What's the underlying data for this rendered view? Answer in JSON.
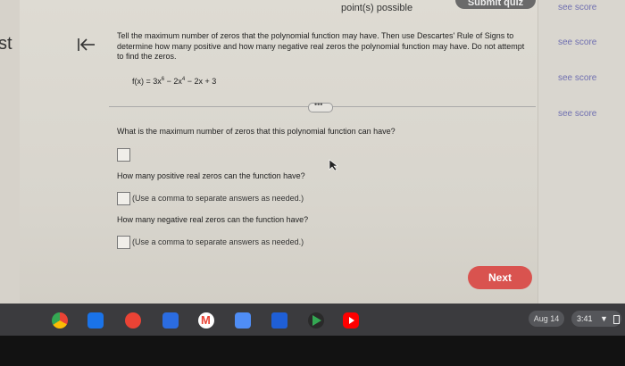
{
  "header": {
    "left_fragment": "st",
    "points_label": "point(s) possible",
    "submit_label": "Submit quiz"
  },
  "sidebar": {
    "see_score": [
      "see score",
      "see score",
      "see score",
      "see score"
    ]
  },
  "question": {
    "instructions": "Tell the maximum number of zeros that the polynomial function may have. Then use Descartes' Rule of Signs to determine how many positive and how many negative real zeros the polynomial function may have. Do not attempt to find the zeros.",
    "function_prefix": "f(x) = 3x",
    "exp1": "6",
    "mid": " − 2x",
    "exp2": "4",
    "suffix": " − 2x + 3",
    "more_label": "•••",
    "q1": "What is the maximum number of zeros that this polynomial function can have?",
    "q2": "How many positive real zeros can the function have?",
    "hint2": "(Use a comma to separate answers as needed.)",
    "q3": "How many negative real zeros can the function have?",
    "hint3": "(Use a comma to separate answers as needed.)"
  },
  "actions": {
    "next_label": "Next"
  },
  "shelf": {
    "date": "Aug 14",
    "time": "3:41",
    "apps": [
      "chrome-icon",
      "classroom-icon",
      "photos-icon",
      "meet-icon",
      "gmail-icon",
      "calendar-icon",
      "files-icon",
      "play-store-icon",
      "youtube-icon"
    ],
    "app_colors": [
      "#f4b400",
      "#1a73e8",
      "#ea4335",
      "#2b6ce0",
      "#ffffff",
      "#4f8df5",
      "#1f5fd6",
      "#34a853",
      "#ff0000"
    ]
  }
}
